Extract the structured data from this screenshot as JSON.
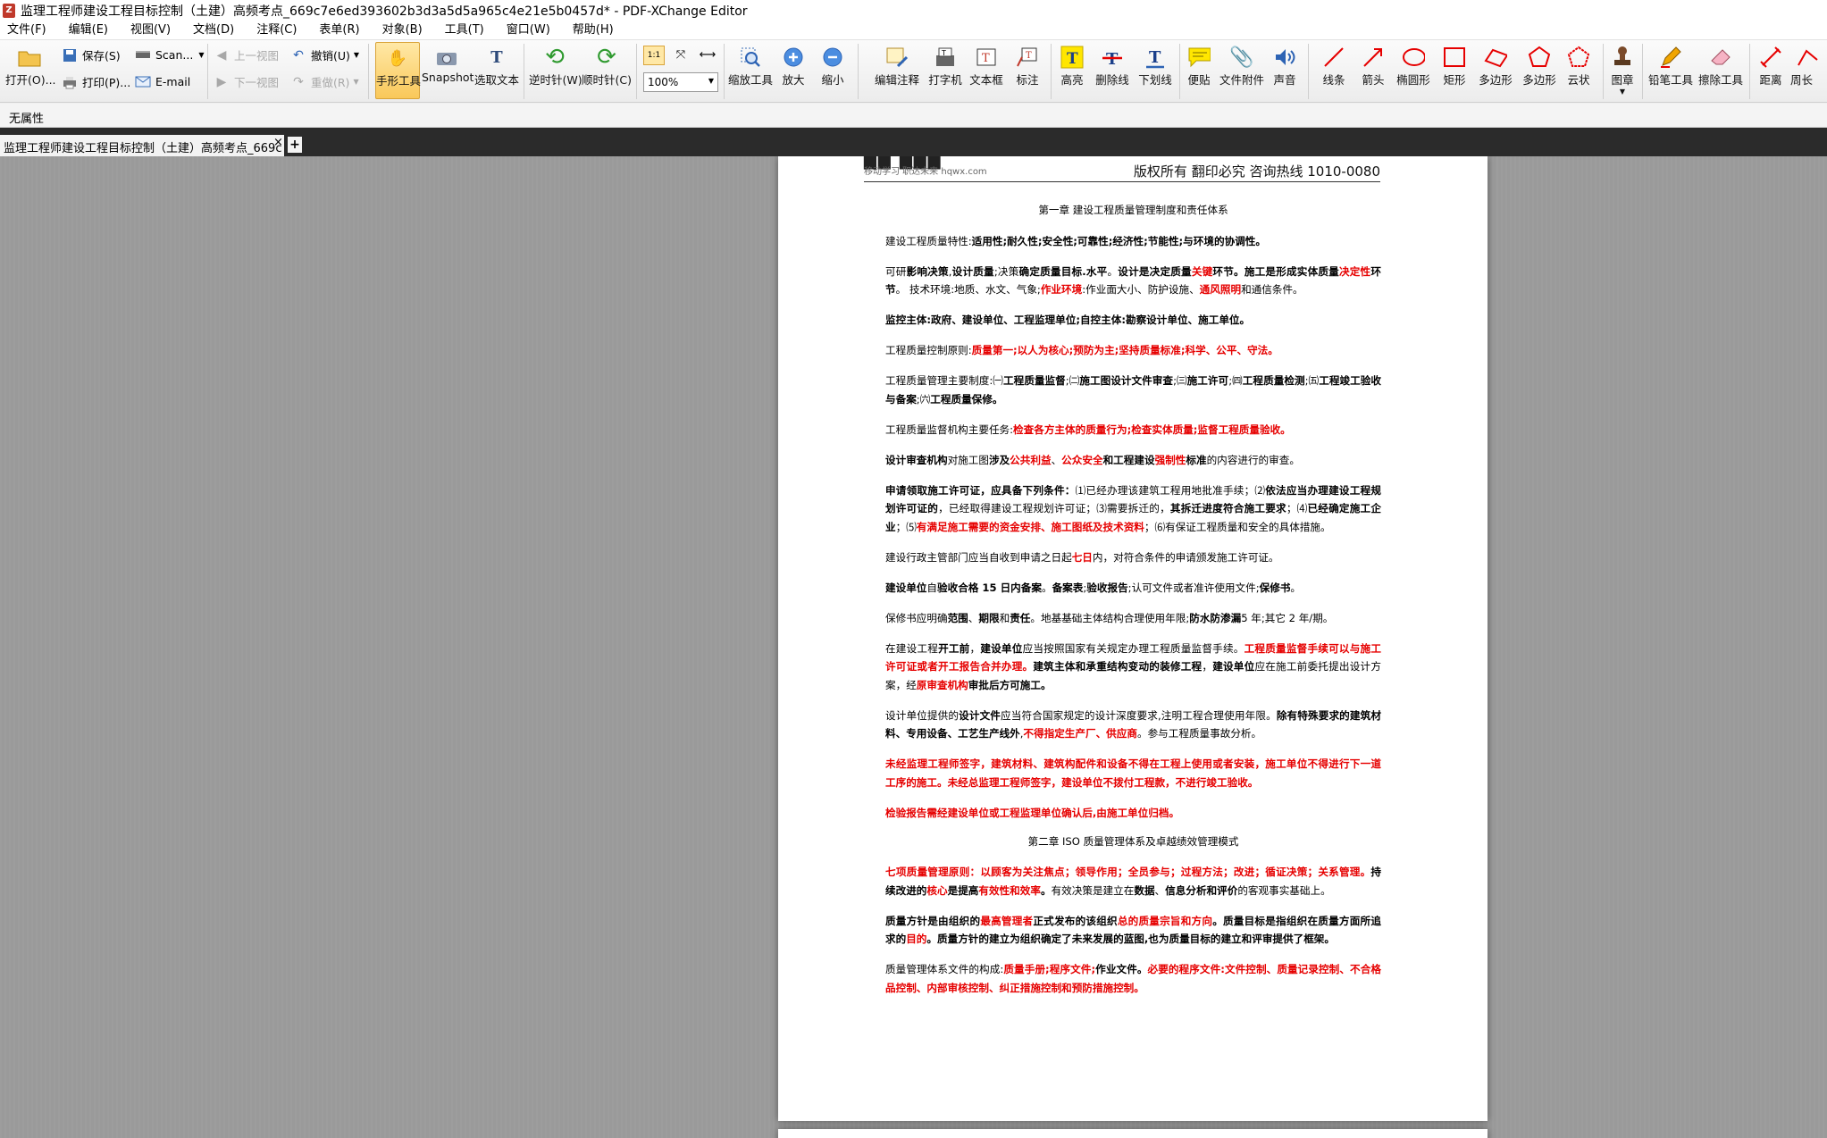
{
  "window": {
    "title": "监理工程师建设工程目标控制（土建）高频考点_669c7e6ed393602b3d3a5d5a965c4e21e5b0457d* - PDF-XChange Editor",
    "icon": "pdf-xchange-icon"
  },
  "menu": [
    "文件(F)",
    "编辑(E)",
    "视图(V)",
    "文档(D)",
    "注释(C)",
    "表单(R)",
    "对象(B)",
    "工具(T)",
    "窗口(W)",
    "帮助(H)"
  ],
  "toolbar": {
    "open": "打开(O)...",
    "save": "保存(S)",
    "print": "打印(P)...",
    "scan": "Scan...",
    "email": "E-mail",
    "prev_view": "上一视图",
    "next_view": "下一视图",
    "undo": "撤销(U)",
    "redo": "重做(R)",
    "hand": "手形工具",
    "snapshot": "Snapshot",
    "select_text": "选取文本",
    "rotate_ccw": "逆时针(W)",
    "rotate_cw": "顺时针(C)",
    "zoom_value": "100%",
    "zoom_tool": "缩放工具",
    "zoom_in": "放大",
    "zoom_out": "缩小",
    "edit_comments": "编辑注释",
    "typewriter": "打字机",
    "textbox": "文本框",
    "callout": "标注",
    "highlight": "高亮",
    "strikeout": "删除线",
    "underline": "下划线",
    "sticky": "便贴",
    "attach": "文件附件",
    "sound": "声音",
    "line": "线条",
    "arrow": "箭头",
    "ellipse": "椭圆形",
    "rectangle": "矩形",
    "polyline": "多边形",
    "polygon": "多边形",
    "cloud": "云状",
    "stamp": "图章",
    "pencil": "铅笔工具",
    "eraser": "擦除工具",
    "distance": "距离",
    "perimeter": "周长"
  },
  "properties": "无属性",
  "tab": {
    "label": "监理工程师建设工程目标控制（土建）高频考点_669c *",
    "close": "×",
    "add": "+"
  },
  "page": {
    "header_right": "版权所有   翻印必究   咨询热线 1010-0080",
    "logo_sub": "移动学习  职达未来   hqwx.com",
    "ch1": "第一章      建设工程质量管理制度和责任体系",
    "p1": [
      "建设工程质量特性:",
      "适用性;耐久性;安全性;可靠性;经济性;节能性;与环境的协调性。"
    ],
    "p2": [
      "可研",
      "影响决策",
      ",",
      "设计质量",
      ";决策",
      "确定质量目标.水平",
      "。",
      "设计是决定质量",
      "关键",
      "环节。",
      "施工是形成实体质量",
      "决定性",
      "环节",
      "。  技术环境:地质、水文、气象;",
      "作业环境",
      ":作业面大小、防护设施、",
      "通风照明",
      "和通信条件。"
    ],
    "p3": "监控主体:政府、建设单位、工程监理单位;自控主体:勘察设计单位、施工单位。",
    "p4": [
      "工程质量控制原则:",
      "质量第一;以人为核心;预防为主;坚持质量标准;科学、公平、守法。"
    ],
    "p5": [
      "工程质量管理主要制度:㈠",
      "工程质量监督",
      ";㈡",
      "施工图设计文件审查",
      ";㈢",
      "施工许可",
      ";㈣",
      "工程质量检测",
      ";㈤",
      "工程竣工验收与备案",
      ";㈥",
      "工程质量保修",
      "。"
    ],
    "p6": [
      "工程质量监督机构主要任务:",
      "检查各方主体的质量行为;检查实体质量;监督工程质量验收。"
    ],
    "p7": [
      "设计审查机构",
      "对施工图",
      "涉及",
      "公共利益",
      "、",
      "公众安全",
      "和",
      "工程建设",
      "强制性",
      "标准",
      "的内容进行的审查。"
    ],
    "p8": [
      "申请领取施工许可证，应具备下列条件：",
      "⑴已经办理该建筑工程用地批准手续；⑵",
      "依法应当办理建设工程规划许可证的",
      "，已经取得建设工程规划许可证；⑶需要拆迁的，",
      "其拆迁进度符合施工要求",
      "；⑷",
      "已经确定施工企业",
      "；⑸",
      "有满足施工需要的资金安排、施工图纸及技术资料",
      "；⑹有保证工程质量和安全的具体措施。"
    ],
    "p9": [
      "建设行政主管部门应当自收到申请之日起",
      "七日",
      "内，对符合条件的申请颁发施工许可证。"
    ],
    "p10": [
      "建设单位",
      "自",
      "验收合格 15 日内备案",
      "。",
      "备案表",
      ";",
      "验收报告",
      ";认可文件或者准许使用文件;",
      "保修书",
      "。"
    ],
    "p11": [
      "保修书应明确",
      "范围",
      "、",
      "期限",
      "和",
      "责任",
      "。地基基础主体结构合理使用年限;",
      "防水防渗漏",
      "5 年;其它 2 年/期。"
    ],
    "p12": [
      "在建设工程",
      "开工前",
      "，",
      "建设单位",
      "应当按照国家有关规定办理工程质量监督手续。",
      "工程质量监督手续可以与施工许可证或者开工报告合并办理。",
      "建筑主体和承重结构变动的装修工程",
      "，",
      "建设单位",
      "应在施工前委托提出设计方案，经",
      "原审查机构",
      "审批后方可施工。"
    ],
    "p13": [
      "设计单位提供的",
      "设计文件",
      "应当符合国家规定的设计深度要求,注明工程合理使用年限。",
      "除有特殊要求的建筑材料、专用设备、工艺生产线外",
      ",",
      "不得指定生产厂、供应商",
      "。参与工程质量事故分析。"
    ],
    "p14": "未经监理工程师签字，建筑材料、建筑构配件和设备不得在工程上使用或者安装，施工单位不得进行下一道工序的施工。未经总监理工程师签字，建设单位不拨付工程款，不进行竣工验收。",
    "p15": "检验报告需经建设单位或工程监理单位确认后,由施工单位归档。",
    "ch2": "第二章      ISO 质量管理体系及卓越绩效管理模式",
    "p16": [
      "七项质量管理原则：以顾客为关注焦点；领导作用；全员参与；过程方法；改进；循证决策；关系管理。",
      "持续改进的",
      "核心",
      "是提高",
      "有效性和效率",
      "。",
      "有效决策是建立在",
      "数据",
      "、",
      "信息分析和评价",
      "的客观事实基础上。"
    ],
    "p17": [
      "质量方针是由组织的",
      "最高管理者",
      "正式发布的该组织",
      "总的质量宗旨和方向",
      "。",
      "质量目标是指组织在质量方面所追求的",
      "目的",
      "。",
      "质量方针的建立为组织确定了未来发展的蓝图,也为质量目标的建立和评审提供了框架。"
    ],
    "p18": [
      "质量管理体系文件的构成:",
      "质量手册;程序文件;",
      "作业文件",
      "。",
      "必要的程序文件:文件控制、质量记录控制、不合格品控制、内部审核控制、纠正措施控制和预防措施控制。"
    ]
  }
}
